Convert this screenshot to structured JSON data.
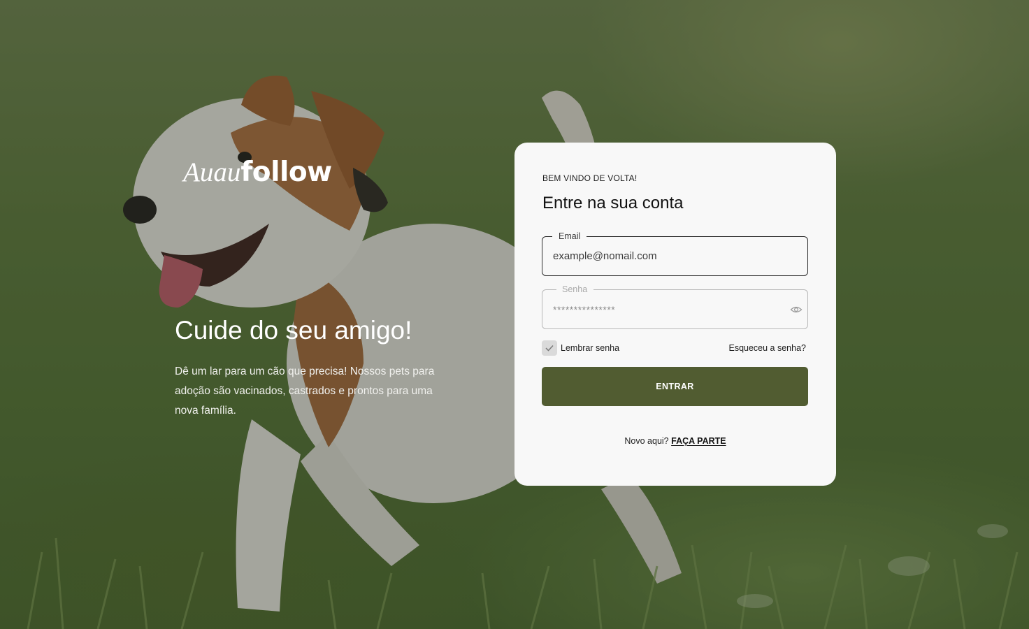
{
  "brand": {
    "name_italic": "Auau",
    "name_bold": "follow"
  },
  "hero": {
    "title": "Cuide do seu amigo!",
    "text": "Dê um lar para um cão que precisa! Nossos pets para adoção são vacinados, castrados e prontos para uma nova família."
  },
  "login": {
    "eyebrow": "BEM VINDO DE VOLTA!",
    "title": "Entre na sua conta",
    "email": {
      "label": "Email",
      "value": "example@nomail.com"
    },
    "password": {
      "label": "Senha",
      "value": "***************",
      "toggle_icon": "eye-icon"
    },
    "remember": {
      "label": "Lembrar senha",
      "checked": true
    },
    "forgot_label": "Esqueceu a senha?",
    "submit_label": "ENTRAR",
    "signup": {
      "prompt": "Novo aqui?",
      "link_label": "FAÇA PARTE"
    }
  },
  "colors": {
    "primary_button": "#515c31",
    "card_background": "#f8f8f8",
    "text_light": "#ffffff"
  }
}
